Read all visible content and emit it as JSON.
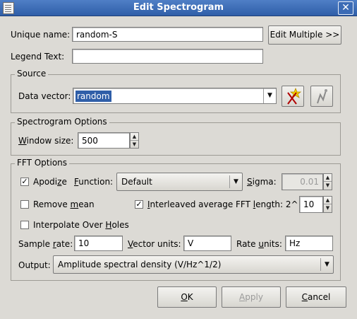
{
  "window": {
    "title": "Edit Spectrogram",
    "close_glyph": "✕"
  },
  "general": {
    "unique_name_label": "Unique name:",
    "unique_name_value": "random-S",
    "edit_multiple_label": "Edit Multiple >>",
    "legend_text_label": "Legend Text:",
    "legend_text_value": ""
  },
  "source": {
    "title": "Source",
    "data_vector_label": "Data vector:",
    "data_vector_value": "random",
    "icons": [
      "new-vector-wizard-icon",
      "edit-vector-icon"
    ]
  },
  "spectrogram_options": {
    "title": "Spectrogram Options",
    "window_size_label": "Window size:",
    "window_size_value": "500"
  },
  "fft_options": {
    "title": "FFT Options",
    "apodize_label": "Apodize",
    "apodize_checked": true,
    "function_label": "Function:",
    "function_value": "Default",
    "sigma_label": "Sigma:",
    "sigma_value": "0.01",
    "remove_mean_label": "Remove mean",
    "remove_mean_checked": false,
    "interleaved_label": "Interleaved average",
    "interleaved_checked": true,
    "fft_length_label": "FFT length: 2^",
    "fft_length_value": "10",
    "interpolate_label": "Interpolate Over Holes",
    "interpolate_checked": false,
    "sample_rate_label": "Sample rate:",
    "sample_rate_value": "10",
    "vector_units_label": "Vector units:",
    "vector_units_value": "V",
    "rate_units_label": "Rate units:",
    "rate_units_value": "Hz",
    "output_label": "Output:",
    "output_value": "Amplitude spectral density (V/Hz^1/2)"
  },
  "buttons": {
    "ok": "OK",
    "apply": "Apply",
    "cancel": "Cancel"
  },
  "colors": {
    "titlebar": "#3b6bb5",
    "dialog_bg": "#dcdad5",
    "selection": "#2f5ea8"
  }
}
